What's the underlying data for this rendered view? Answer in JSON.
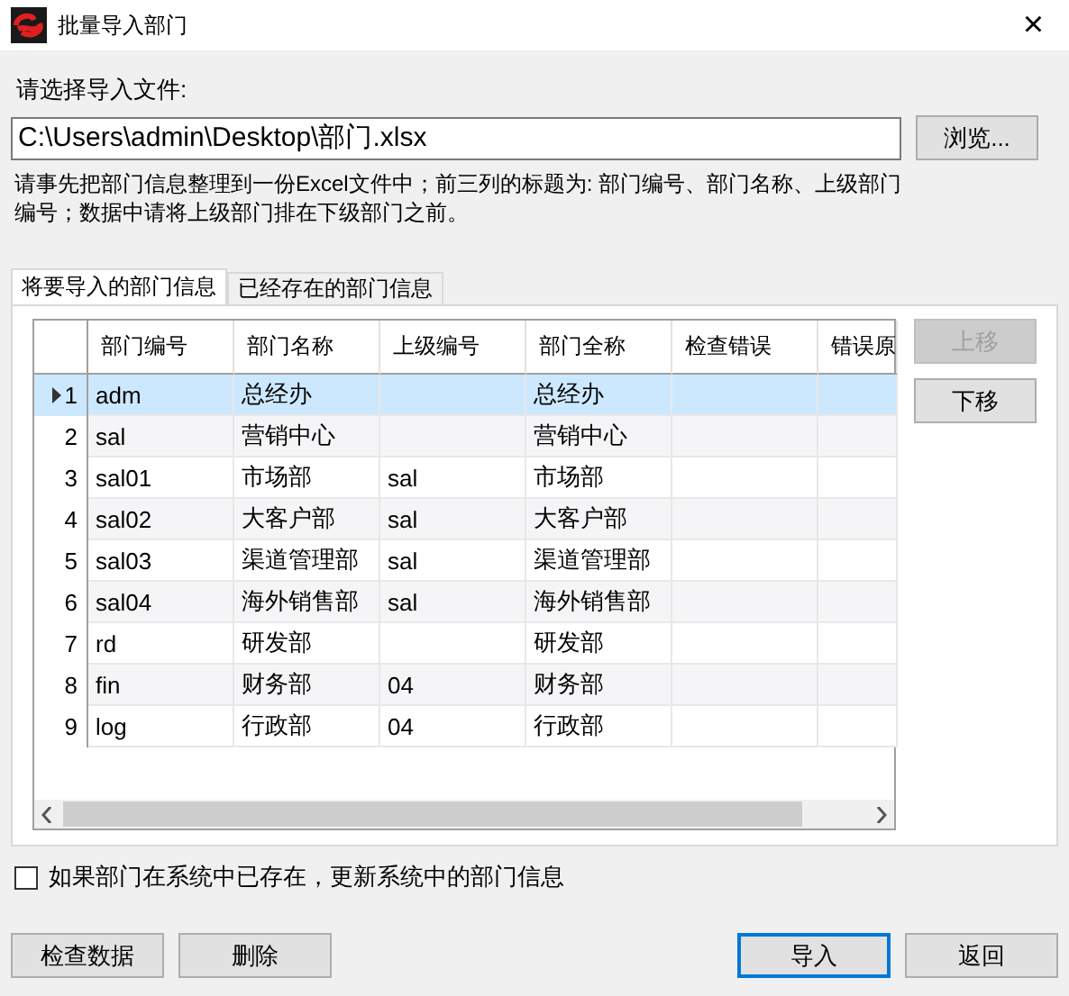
{
  "window": {
    "title": "批量导入部门",
    "close": "×"
  },
  "file_label": "请选择导入文件:",
  "file_path": "C:\\Users\\admin\\Desktop\\部门.xlsx",
  "browse_button": {
    "label": "浏览...",
    "disabled": false
  },
  "hint": "请事先把部门信息整理到一份Excel文件中；前三列的标题为: 部门编号、部门名称、上级部门编号；数据中请将上级部门排在下级部门之前。",
  "tabs": [
    {
      "label": "将要导入的部门信息",
      "selected": true
    },
    {
      "label": "已经存在的部门信息",
      "selected": false
    }
  ],
  "table": {
    "columns": [
      "部门编号",
      "部门名称",
      "上级编号",
      "部门全称",
      "检查错误",
      "错误原"
    ],
    "rows": [
      {
        "number": "1",
        "selected": true,
        "cells": [
          "adm",
          "总经办",
          null,
          "总经办",
          null,
          null
        ]
      },
      {
        "number": "2",
        "selected": false,
        "cells": [
          "sal",
          "营销中心",
          null,
          "营销中心",
          null,
          null
        ]
      },
      {
        "number": "3",
        "selected": false,
        "cells": [
          "sal01",
          "市场部",
          "sal",
          "市场部",
          null,
          null
        ]
      },
      {
        "number": "4",
        "selected": false,
        "cells": [
          "sal02",
          "大客户部",
          "sal",
          "大客户部",
          null,
          null
        ]
      },
      {
        "number": "5",
        "selected": false,
        "cells": [
          "sal03",
          "渠道管理部",
          "sal",
          "渠道管理部",
          null,
          null
        ]
      },
      {
        "number": "6",
        "selected": false,
        "cells": [
          "sal04",
          "海外销售部",
          "sal",
          "海外销售部",
          null,
          null
        ]
      },
      {
        "number": "7",
        "selected": false,
        "cells": [
          "rd",
          "研发部",
          null,
          "研发部",
          null,
          null
        ]
      },
      {
        "number": "8",
        "selected": false,
        "cells": [
          "fin",
          "财务部",
          "04",
          "财务部",
          null,
          null
        ]
      },
      {
        "number": "9",
        "selected": false,
        "cells": [
          "log",
          "行政部",
          "04",
          "行政部",
          null,
          null
        ]
      }
    ]
  },
  "side_buttons": [
    {
      "label": "上移",
      "disabled": true
    },
    {
      "label": "下移",
      "disabled": false
    }
  ],
  "update_option": {
    "label": "如果部门在系统中已存在，更新系统中的部门信息",
    "checked": false
  },
  "bottom_buttons": {
    "left": [
      {
        "label": "检查数据",
        "default": false
      },
      {
        "label": "删除",
        "default": false
      }
    ],
    "right": [
      {
        "label": "导入",
        "default": true
      },
      {
        "label": "返回",
        "default": false
      }
    ]
  }
}
